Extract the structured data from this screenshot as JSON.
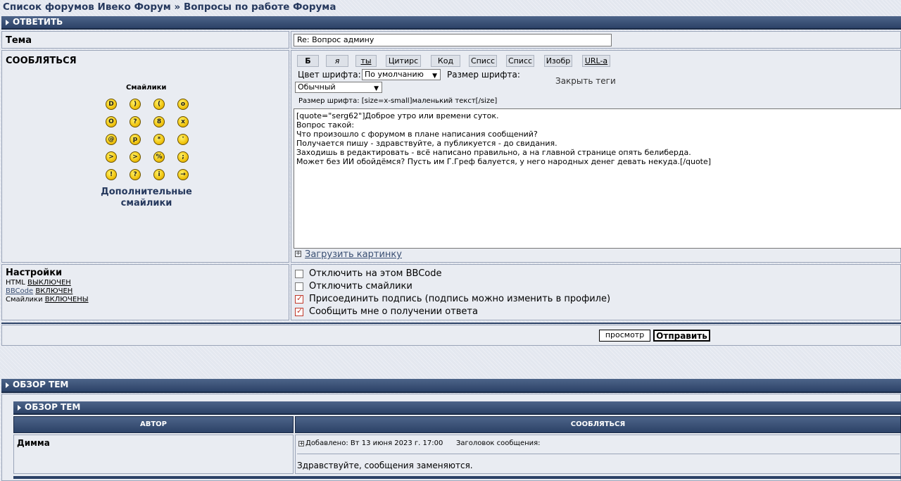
{
  "breadcrumb": {
    "forum_list": "Список форумов Ивеко Форум",
    "separator": "»",
    "forum": "Вопросы по работе Форума"
  },
  "reply_header": "ОТВЕТИТЬ",
  "subject": {
    "label": "Тема",
    "value": "Re: Вопрос админу"
  },
  "message": {
    "label": "СООБЛЯТЬСЯ"
  },
  "smilies": {
    "title": "Смайлики",
    "more": "Дополнительные смайлики",
    "icons": [
      "very-happy-icon",
      "smile-icon",
      "sad-icon",
      "surprised-icon",
      "shocked-icon",
      "confused-icon",
      "cool-icon",
      "laughing-icon",
      "mad-icon",
      "razz-icon",
      "embarassed-icon",
      "crying-icon",
      "evil-icon",
      "twisted-evil-icon",
      "rolling-eyes-icon",
      "wink-icon",
      "exclamation-icon",
      "question-icon",
      "idea-icon",
      "arrow-icon"
    ]
  },
  "bbcode": {
    "buttons": [
      "Б",
      "я",
      "ты",
      "Цитирс",
      "Код",
      "Списс",
      "Списс",
      "Изобр",
      "URL-a"
    ],
    "font_color_label": "Цвет шрифта:",
    "font_color_value": "По умолчанию",
    "font_size_label": "Размер шрифта:",
    "font_size_value": "Обычный",
    "close_tags": "Закрыть теги",
    "help_line": "Размер шрифта: [size=x-small]маленький текст[/size]"
  },
  "textarea_lines": [
    "[quote=\"serg62\"]Доброе утро или времени суток.",
    "Вопрос такой:",
    "Что произошло с форумом в плане написания сообщений?",
    "Получается пишу - здравствуйте, а публикуется - до свидания.",
    "Заходишь в редактировать - всё написано правильно, а на главной странице опять белиберда.",
    "Может без ИИ обойдёмся? Пусть им Г.Греф балуется, у него народных денег девать некуда.[/quote]"
  ],
  "upload_image": "Загрузить картинку",
  "settings": {
    "label": "Настройки",
    "html_label": "HTML",
    "html_state": "ВЫКЛЮЧЕН",
    "bbcode_label": "BBCode",
    "bbcode_state": "ВКЛЮЧЕН",
    "smilies_label": "Смайлики",
    "smilies_state": "ВКЛЮЧЕНЫ"
  },
  "options": [
    {
      "label": "Отключить на этом BBCode",
      "checked": false
    },
    {
      "label": "Отключить смайлики",
      "checked": false
    },
    {
      "label": "Присоединить подпись (подпись можно изменить в профиле)",
      "checked": true
    },
    {
      "label": "Сообщить мне о получении ответа",
      "checked": true
    }
  ],
  "buttons": {
    "preview": "просмотр",
    "submit": "Отправить"
  },
  "topic_review": {
    "header": "ОБЗОР ТЕМ",
    "inner_header": "ОБЗОР ТЕМ",
    "col_author": "АВТОР",
    "col_message": "СООБЛЯТЬСЯ",
    "post": {
      "author": "Димма",
      "posted": "Добавлено: Вт 13 июня 2023 г. 17:00",
      "subject_label": "Заголовок сообщения:",
      "body": "Здравствуйте, сообщения заменяются."
    }
  },
  "colors": {
    "header_bar": "#2c4267",
    "link": "#26395e",
    "checkbox_check": "#c0392b"
  }
}
